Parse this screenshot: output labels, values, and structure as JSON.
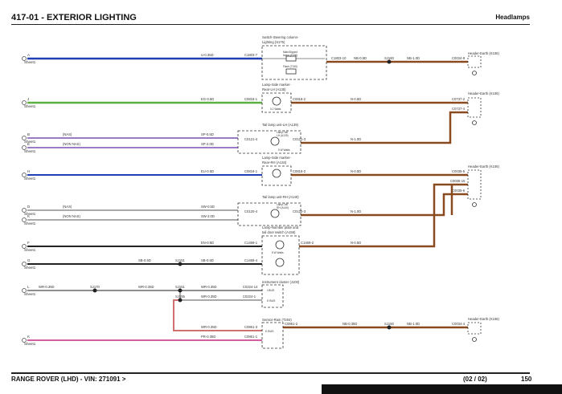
{
  "header": {
    "title": "417-01 - EXTERIOR LIGHTING",
    "subtitle": "Headlamps"
  },
  "footer": {
    "vehicle": "RANGE ROVER  (LHD) - VIN: 271091 >",
    "page_of": "(02 / 02)",
    "page_number": "150"
  },
  "colors": {
    "blue": "#1f3fb5",
    "green": "#5ab040",
    "violet": "#7a50b0",
    "brown": "#8a4a20",
    "black": "#222222",
    "grey": "#8e8e8e",
    "pink": "#d060a0",
    "salmon": "#d07070"
  },
  "diagram": {
    "sheet_label": "Sheet1",
    "pins": [
      "A",
      "J",
      "B",
      "E",
      "H",
      "D",
      "K",
      "F",
      "G",
      "L",
      "K"
    ],
    "texts": [
      "U-0.35D",
      "C1803-7",
      "Switch-Steering column-",
      "Lighting (S175)",
      "Main/Dipped",
      "beam (T190)",
      "Flash (T190)",
      "C1803-10",
      "NB-0.5D",
      "SJ160",
      "NB-1.0D",
      "C0034-9",
      "Header-Earth (K106)",
      "Lamp-Side marker-",
      "Rear-LH (A135)",
      "EG-0.5D",
      "C0818-1",
      "C0818-2",
      "N-0.5D",
      "C0737-2",
      "C0737-4",
      "0.2 Watts",
      "Tail lamp unit-LH (A139)",
      "(NAS)",
      "(NON NAS)",
      "SP-0.5D",
      "SP-2.0D",
      "C0121-4",
      "Lamp-Tail",
      "LH (A139)",
      "C0121-3",
      "N-1.0D",
      "5 W Watts",
      "EU-0.5D",
      "C0818-1",
      "Lamp-Side marker-",
      "Rear-RH (A134)",
      "C0818-2",
      "N-0.5D",
      "C0035-5",
      "C0035-15",
      "C0035-6",
      "Tail lamp unit-RH (A140)",
      "(NAS)",
      "(NON NAS)",
      "SW-0.5D",
      "SW-2.0D",
      "C0120-4",
      "Lamp-Tail",
      "RH (A140)",
      "C0120-3",
      "N-1.0D",
      "Lamp-Number plate and",
      "tail door switch (A155)",
      "EN-0.5D",
      "C1469-1",
      "C1469-2",
      "N-0.5D",
      "SB-0.5D",
      "SJ151",
      "SB-0.5D",
      "C1469-4",
      "5 W Watts",
      "WR-0.35D",
      "SJ170",
      "WR-0.35D",
      "SJ151",
      "WR-0.35D",
      "C0224-14",
      "Instrument cluster (J100)",
      "I-BUS",
      "SJ155",
      "WR-0.35D",
      "C0224-1",
      "K BUS",
      "Sensor-Rain (T204)",
      "WR-0.35D",
      "C0861-3",
      "C0861-2",
      "NB-0.35D",
      "SJ150",
      "NB-1.0D",
      "C0034-4",
      "Header-Earth (K106)",
      "K BUS",
      "PR-0.35D",
      "C0861-1"
    ]
  }
}
